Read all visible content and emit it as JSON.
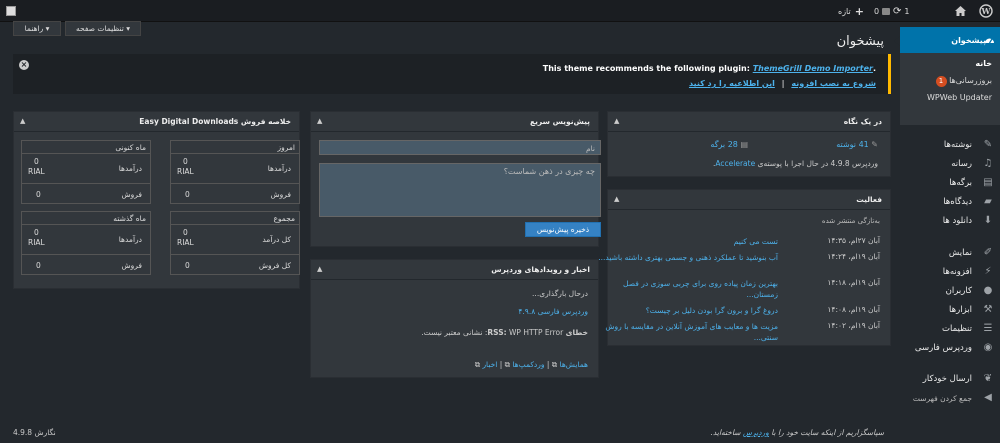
{
  "adminbar": {
    "new_label": "تازه",
    "comments_count": "0",
    "updates_count": "1"
  },
  "sidebar": {
    "dashboard": "پیشخوان",
    "home": "خانه",
    "updates": "بروزرسانی‌ها",
    "updates_badge": "1",
    "wpweb": "WPWeb Updater",
    "items": [
      {
        "label": "نوشته‌ها",
        "icon": "pin-icon"
      },
      {
        "label": "رسانه",
        "icon": "media-icon"
      },
      {
        "label": "برگه‌ها",
        "icon": "page-icon"
      },
      {
        "label": "دیدگاه‌ها",
        "icon": "comment-icon"
      },
      {
        "label": "دانلود ها",
        "icon": "download-icon"
      },
      {
        "label": "نمایش",
        "icon": "brush-icon"
      },
      {
        "label": "افزونه‌ها",
        "icon": "plugin-icon"
      },
      {
        "label": "کاربران",
        "icon": "user-icon"
      },
      {
        "label": "ابزارها",
        "icon": "wrench-icon"
      },
      {
        "label": "تنظیمات",
        "icon": "settings-icon"
      },
      {
        "label": "وردپرس فارسی",
        "icon": "globe-icon"
      },
      {
        "label": "ارسال خودکار",
        "icon": "leaf-icon"
      }
    ],
    "collapse": "جمع کردن فهرست"
  },
  "header": {
    "screen_options": "تنظیمات صفحه ▾",
    "help": "راهنما ▾",
    "title": "پیشخوان"
  },
  "notice": {
    "before": "This theme recommends the following plugin: ",
    "plugin": "ThemeGrill Demo Importer",
    "after": ".",
    "install": "شروع به نصب افزونه",
    "sep": "|",
    "dismiss": "این اطلاعیه را رد کنید"
  },
  "glance": {
    "title": "در یک نگاه",
    "posts": "41 نوشته",
    "pages": "28 برگه",
    "footer_prefix": "وردپرس 4.9.8 در حال اجرا با پوسته‌ی ",
    "theme": "Accelerate",
    "footer_suffix": "."
  },
  "activity": {
    "title": "فعالیت",
    "subtitle": "به‌تازگی منتشر شده",
    "rows": [
      {
        "date": "آبان ۲۷ام، ۱۴:۳۵",
        "title": "تست می کنیم"
      },
      {
        "date": "آبان ۱۹ام، ۱۴:۲۴",
        "title": "آب بنوشید تا عملکرد ذهنی و جسمی بهتری داشته باشید..."
      },
      {
        "date": "آبان ۱۹ام، ۱۴:۱۸",
        "title": "بهترین زمان پیاده روی برای چربی سوزی در فصل زمستان..."
      },
      {
        "date": "آبان ۱۹ام، ۱۴:۰۸",
        "title": "دروغ گرا و برون گرا بودن دلیل بر چیست؟"
      },
      {
        "date": "آبان ۱۹ام، ۱۴:۰۲",
        "title": "مزیت ها و معایب های آموزش آنلاین در مقایسه با روش سنتی..."
      }
    ]
  },
  "quickdraft": {
    "title": "پیش‌نویس سریع",
    "title_placeholder": "نام",
    "content_placeholder": "چه چیزی در ذهن شماست؟",
    "save": "ذخیره پیش‌نویس"
  },
  "news": {
    "title": "اخبار و رویدادهای وردپرس",
    "loading": "درحال بارگذاری...",
    "link": "وردپرس فارسی ۴.۹.۸",
    "error_label": "خطای",
    "error_rss": "RSS:",
    "error_msg": " WP HTTP Error: نشانی معتبر نیست.",
    "footer": [
      "همایش‌ها",
      "وردکمپ‌ها",
      "اخبار"
    ]
  },
  "edd": {
    "title": "خلاصه فروش Easy Digital Downloads",
    "boxes": [
      {
        "title": "امروز",
        "r1": "درآمدها",
        "r1v": "0\nRIAL",
        "r2": "فروش",
        "r2v": "0"
      },
      {
        "title": "ماه کنونی",
        "r1": "درآمدها",
        "r1v": "0\nRIAL",
        "r2": "فروش",
        "r2v": "0"
      },
      {
        "title": "مجموع",
        "r1": "کل درآمد",
        "r1v": "0\nRIAL",
        "r2": "کل فروش",
        "r2v": "0"
      },
      {
        "title": "ماه گذشته",
        "r1": "درآمدها",
        "r1v": "0\nRIAL",
        "r2": "فروش",
        "r2v": "0"
      }
    ]
  },
  "footer": {
    "thanks_prefix": "سپاسگزاریم از اینکه سایت خود را با ",
    "thanks_link": "وردپرس",
    "thanks_suffix": " ساخته‌اید.",
    "version": "نگارش 4.9.8"
  },
  "colors": {
    "accent": "#0073aa",
    "notice_border": "#ffb900",
    "link": "#4db2ec"
  }
}
